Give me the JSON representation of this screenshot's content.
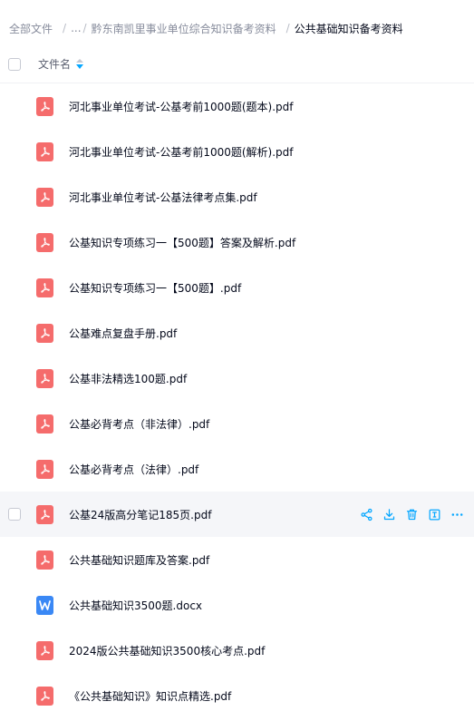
{
  "breadcrumb": {
    "root": "全部文件",
    "ellipsis": "...",
    "parent": "黔东南凯里事业单位综合知识备考资料",
    "current": "公共基础知识备考资料",
    "separator": "/"
  },
  "header": {
    "column_name": "文件名"
  },
  "files": [
    {
      "name": "河北事业单位考试-公基考前1000题(题本).pdf",
      "type": "pdf"
    },
    {
      "name": "河北事业单位考试-公基考前1000题(解析).pdf",
      "type": "pdf"
    },
    {
      "name": "河北事业单位考试-公基法律考点集.pdf",
      "type": "pdf"
    },
    {
      "name": "公基知识专项练习一【500题】答案及解析.pdf",
      "type": "pdf"
    },
    {
      "name": "公基知识专项练习一【500题】.pdf",
      "type": "pdf"
    },
    {
      "name": "公基难点复盘手册.pdf",
      "type": "pdf"
    },
    {
      "name": "公基非法精选100题.pdf",
      "type": "pdf"
    },
    {
      "name": "公基必背考点（非法律）.pdf",
      "type": "pdf"
    },
    {
      "name": "公基必背考点（法律）.pdf",
      "type": "pdf"
    },
    {
      "name": "公基24版高分笔记185页.pdf",
      "type": "pdf",
      "hovered": true
    },
    {
      "name": "公共基础知识题库及答案.pdf",
      "type": "pdf"
    },
    {
      "name": "公共基础知识3500题.docx",
      "type": "docx"
    },
    {
      "name": "2024版公共基础知识3500核心考点.pdf",
      "type": "pdf"
    },
    {
      "name": "《公共基础知识》知识点精选.pdf",
      "type": "pdf"
    }
  ],
  "row_actions": [
    "share-icon",
    "download-icon",
    "delete-icon",
    "rename-icon",
    "more-icon"
  ],
  "colors": {
    "accent": "#06a7ff",
    "pdf": "#f56c6c",
    "doc": "#3a88f5"
  }
}
